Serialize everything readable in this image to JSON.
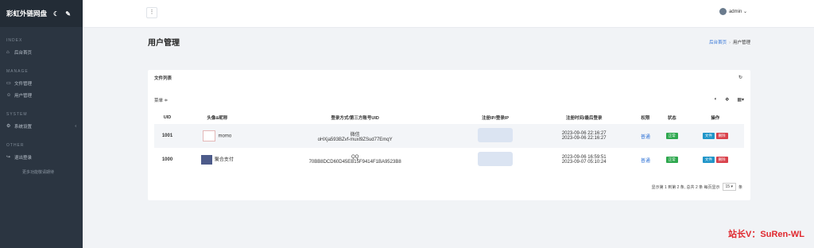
{
  "sidebar": {
    "brand": "彩虹外链网盘",
    "sections": [
      {
        "title": "INDEX",
        "items": [
          {
            "label": "后台首页",
            "icon": "home-icon"
          }
        ]
      },
      {
        "title": "MANAGE",
        "items": [
          {
            "label": "文件管理",
            "icon": "folder-icon"
          },
          {
            "label": "用户管理",
            "icon": "users-icon"
          }
        ]
      },
      {
        "title": "SYSTEM",
        "items": [
          {
            "label": "系统设置",
            "icon": "gear-icon"
          }
        ]
      },
      {
        "title": "OTHER",
        "items": [
          {
            "label": "退出登录",
            "icon": "logout-icon"
          }
        ]
      }
    ],
    "more": "更多功能敬请期待"
  },
  "topbar": {
    "user": "admin"
  },
  "page": {
    "title": "用户管理",
    "crumb_home": "后台首页",
    "crumb_current": "用户管理"
  },
  "card": {
    "title": "文件列表",
    "select_label": "菜单"
  },
  "table": {
    "headers": [
      "UID",
      "头像&昵称",
      "登录方式/第三方账号UID",
      "注册IP/登录IP",
      "注册时间/最后登录",
      "权限",
      "状态",
      "操作"
    ],
    "rows": [
      {
        "uid": "1001",
        "nickname": "momo",
        "login_type": "微信",
        "account": "oHXja593BZvf-muxl9ZSud77EmqY",
        "reg_time": "2023-09-06 22:16:27",
        "last_login": "2023-09-06 22:16:27",
        "perm": "普通",
        "status": "正常",
        "op_file": "文件",
        "op_del": "删除"
      },
      {
        "uid": "1000",
        "nickname": "聚合支付",
        "login_type": "QQ",
        "account": "70BB8DCD60D45EB15F9414F1BA9523B8",
        "reg_time": "2023-09-06 16:59:51",
        "last_login": "2023-09-07 05:10:24",
        "perm": "普通",
        "status": "正常",
        "op_file": "文件",
        "op_del": "删除"
      }
    ]
  },
  "pager": {
    "text": "显示第 1 到第 2 条, 总共 2 条  每页显示",
    "size": "15",
    "unit": "条"
  },
  "watermark": "站长V：SuRen-WL"
}
